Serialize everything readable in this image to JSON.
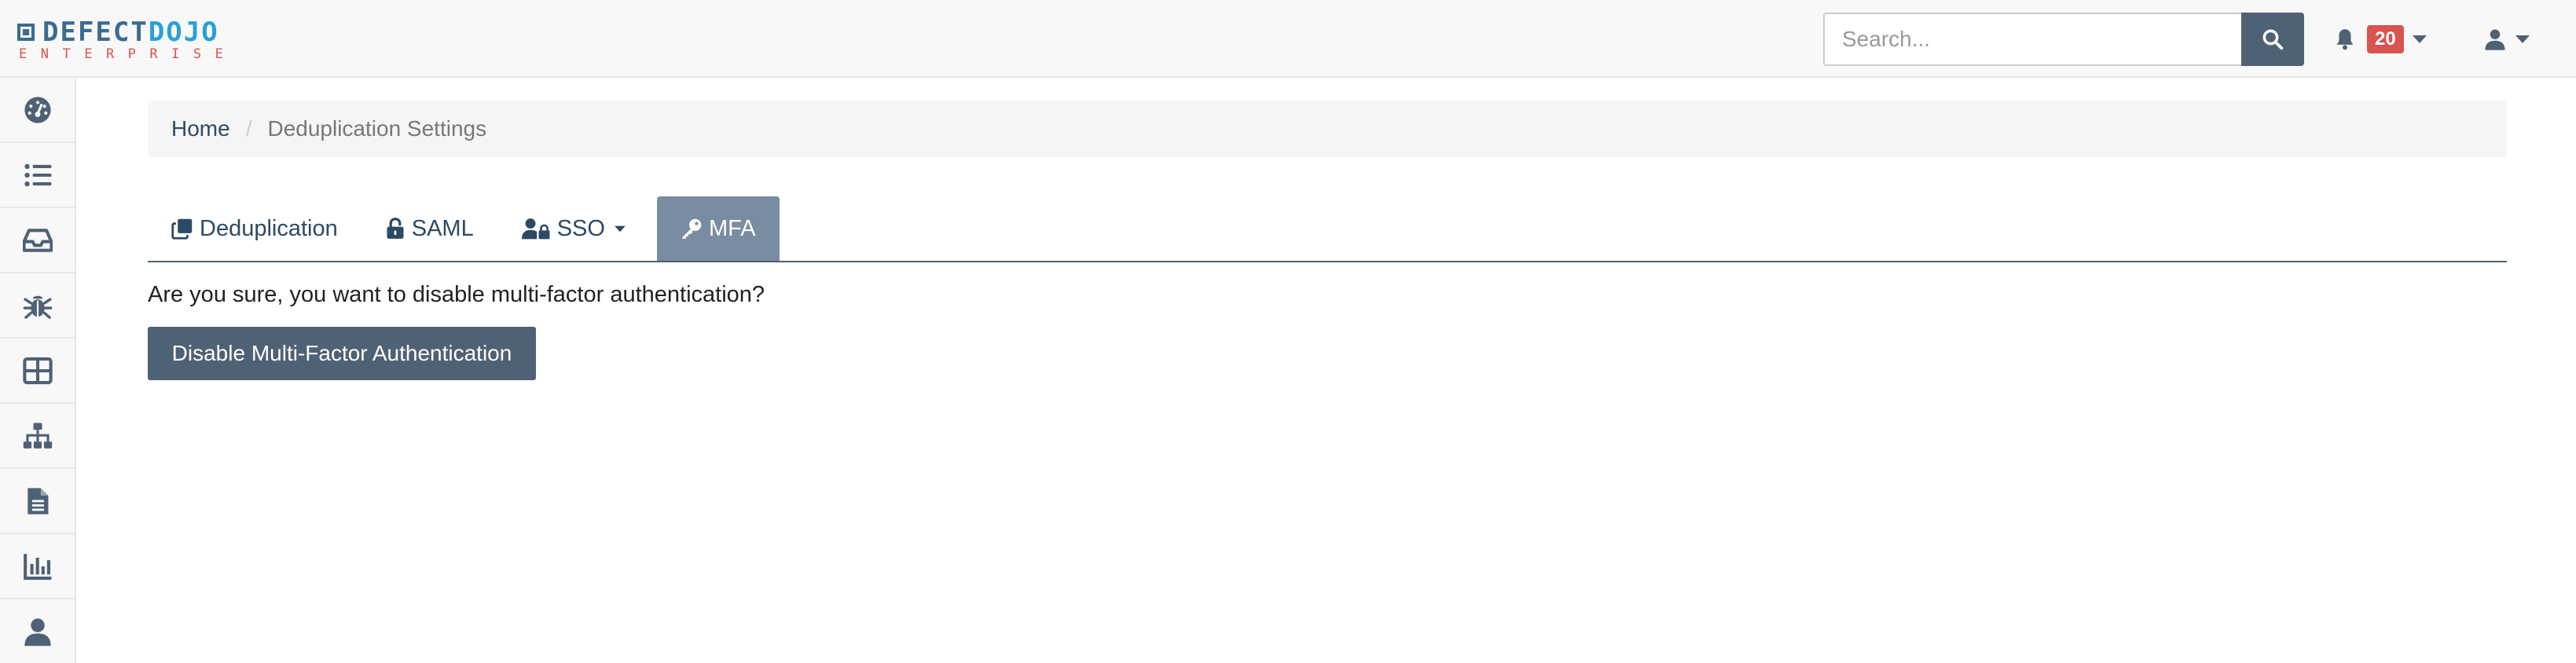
{
  "brand": {
    "logo_word_1": "DEFECT",
    "logo_word_2": "DOJO",
    "logo_sub": "ENTERPRISE",
    "colors": {
      "primary": "#3b6b8f",
      "accent": "#2a9fd6",
      "sub": "#d9534f"
    }
  },
  "header": {
    "search": {
      "placeholder": "Search...",
      "icon": "search-icon"
    },
    "notifications": {
      "icon": "bell-icon",
      "count": "20"
    },
    "user_menu": {
      "icon": "user-icon"
    }
  },
  "sidebar": {
    "items": [
      {
        "name": "dashboard",
        "icon": "dashboard-icon"
      },
      {
        "name": "products",
        "icon": "list-icon"
      },
      {
        "name": "engagements",
        "icon": "inbox-icon"
      },
      {
        "name": "findings",
        "icon": "bug-icon"
      },
      {
        "name": "components",
        "icon": "table-icon"
      },
      {
        "name": "endpoints",
        "icon": "sitemap-icon"
      },
      {
        "name": "reports",
        "icon": "file-icon"
      },
      {
        "name": "metrics",
        "icon": "chart-icon"
      },
      {
        "name": "users",
        "icon": "user-icon"
      }
    ]
  },
  "breadcrumb": {
    "home": "Home",
    "current": "Deduplication Settings"
  },
  "tabs": [
    {
      "label": "Deduplication",
      "icon": "copy-icon",
      "active": false
    },
    {
      "label": "SAML",
      "icon": "unlock-icon",
      "active": false
    },
    {
      "label": "SSO",
      "icon": "user-lock-icon",
      "active": false,
      "dropdown": true
    },
    {
      "label": "MFA",
      "icon": "key-icon",
      "active": true
    }
  ],
  "content": {
    "confirm_text": "Are you sure, you want to disable multi-factor authentication?",
    "disable_button": "Disable Multi-Factor Authentication"
  },
  "theme": {
    "button_bg": "#4f6175",
    "active_tab_bg": "#7a8ca1",
    "badge_bg": "#d9534f"
  }
}
